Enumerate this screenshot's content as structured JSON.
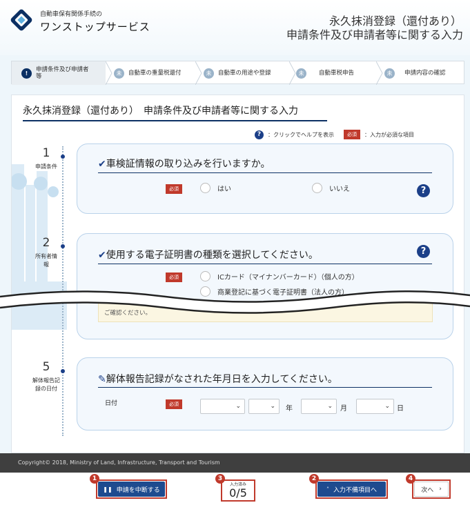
{
  "header": {
    "logo_small": "自動車保有関係手続の",
    "logo_big": "ワンストップサービス",
    "title_line1": "永久抹消登録（還付あり）",
    "title_line2": "申請条件及び申請者等に関する入力"
  },
  "steps": [
    {
      "num": "!",
      "label": "申請条件及び申請者等"
    },
    {
      "num": "未",
      "label": "自動車の重量税還付"
    },
    {
      "num": "未",
      "label": "自動車の用途や登録"
    },
    {
      "num": "未",
      "label": "自動車税申告"
    },
    {
      "num": "未",
      "label": "申請内容の確認"
    }
  ],
  "section": {
    "title": "永久抹消登録（還付あり）　申請条件及び申請者等に関する入力",
    "legend_help_icon": "?",
    "legend_help_text": "：クリックでヘルプを表示",
    "legend_required": "必須",
    "legend_required_text": "：入力が必須な項目"
  },
  "questions": {
    "q1": {
      "num": "1",
      "name": "申請条件",
      "title": "車検証情報の取り込みを行いますか。",
      "required": "必須",
      "opt_yes": "はい",
      "opt_no": "いいえ"
    },
    "q2": {
      "num": "2",
      "name": "所有者情報",
      "title": "使用する電子証明書の種類を選択してください。",
      "required": "必須",
      "opt_ic": "ICカード（マイナンバーカード）（個人の方）",
      "opt_corp": "商業登記に基づく電子証明書（法人の方）",
      "notice": "ご確認ください。"
    },
    "q5": {
      "num": "5",
      "name": "解体報告記録の日付",
      "title": "解体報告記録がなされた年月日を入力してください。",
      "field_label": "日付",
      "required": "必須",
      "unit_year": "年",
      "unit_month": "月",
      "unit_day": "日"
    }
  },
  "footer": {
    "copyright": "Copyright© 2018, Ministry of Land, Infrastructure, Transport and Tourism"
  },
  "bottom": {
    "suspend": "申請を中断する",
    "progress_label": "入力済み",
    "progress_value": "0/5",
    "to_missing": "入力不備項目へ",
    "next": "次へ",
    "badge1": "1",
    "badge2": "2",
    "badge3": "3",
    "badge4": "4"
  }
}
